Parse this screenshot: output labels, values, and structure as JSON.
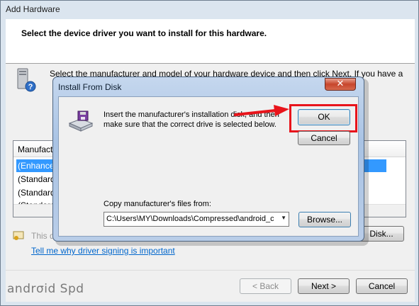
{
  "outer": {
    "title": "Add Hardware",
    "heading": "Select the device driver you want to install for this hardware.",
    "instruction": "Select the manufacturer and model of your hardware device and then click Next. If you have a",
    "list_header": "Manufactu",
    "list_rows": [
      "(Enhance",
      "(Standard",
      "(Standard",
      "(Standard"
    ],
    "signed_text": "This d",
    "have_disk_label": "Disk...",
    "signing_link": "Tell me why driver signing is important",
    "back_label": "< Back",
    "next_label": "Next >",
    "cancel_label": "Cancel"
  },
  "dialog": {
    "title": "Install From Disk",
    "close_glyph": "✕",
    "message": "Insert the manufacturer's installation disk, and then make sure that the correct drive is selected below.",
    "ok_label": "OK",
    "cancel_label": "Cancel",
    "copy_label": "Copy manufacturer's files from:",
    "path_value": "C:\\Users\\MY\\Downloads\\Compressed\\android_cc",
    "browse_label": "Browse..."
  },
  "watermark": "andrσid Spd",
  "icons": {
    "hardware": "hardware-icon",
    "disk": "disk-drive-icon",
    "signed": "driver-signed-icon",
    "arrow": "red-arrow"
  },
  "colors": {
    "highlight": "#e8141b",
    "selection": "#3399ff",
    "link": "#0066cc"
  }
}
